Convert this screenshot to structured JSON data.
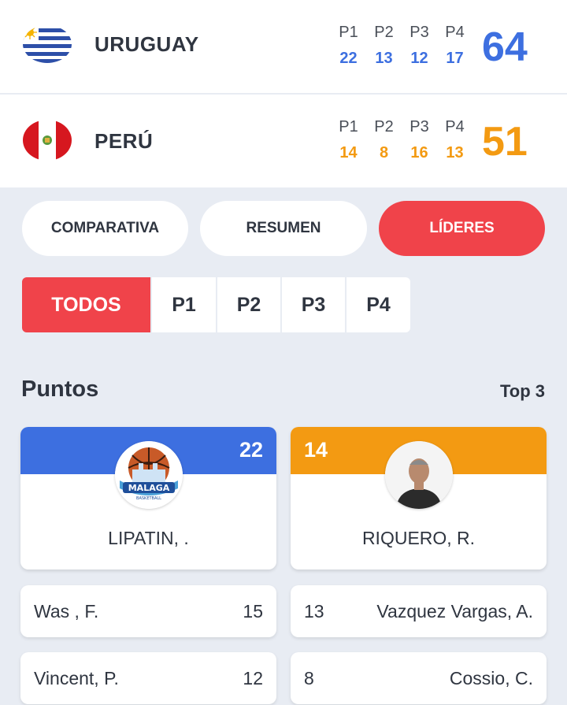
{
  "home": {
    "name": "URUGUAY",
    "flag": "uruguay-flag-icon",
    "period_labels": [
      "P1",
      "P2",
      "P3",
      "P4"
    ],
    "periods": [
      "22",
      "13",
      "12",
      "17"
    ],
    "total": "64",
    "color": "#3d6fe0"
  },
  "away": {
    "name": "PERÚ",
    "flag": "peru-flag-icon",
    "period_labels": [
      "P1",
      "P2",
      "P3",
      "P4"
    ],
    "periods": [
      "14",
      "8",
      "16",
      "13"
    ],
    "total": "51",
    "color": "#f39a12"
  },
  "view_tabs": [
    {
      "label": "COMPARATIVA",
      "active": false
    },
    {
      "label": "RESUMEN",
      "active": false
    },
    {
      "label": "LÍDERES",
      "active": true
    }
  ],
  "period_filter": [
    {
      "label": "TODOS",
      "active": true
    },
    {
      "label": "P1",
      "active": false
    },
    {
      "label": "P2",
      "active": false
    },
    {
      "label": "P3",
      "active": false
    },
    {
      "label": "P4",
      "active": false
    }
  ],
  "section": {
    "title": "Puntos",
    "top_label": "Top 3"
  },
  "leaders": {
    "home": {
      "value": "22",
      "name": "LIPATIN,  .",
      "avatar": "malaga-team-logo"
    },
    "away": {
      "value": "14",
      "name": "RIQUERO, R.",
      "avatar": "player-photo"
    }
  },
  "others": {
    "home": [
      {
        "name": "Was , F.",
        "value": "15"
      },
      {
        "name": "Vincent, P.",
        "value": "12"
      }
    ],
    "away": [
      {
        "name": "Vazquez Vargas, A.",
        "value": "13"
      },
      {
        "name": "Cossio, C.",
        "value": "8"
      }
    ]
  },
  "colors": {
    "accent": "#f0434a",
    "home": "#3d6fe0",
    "away": "#f39a12",
    "background": "#e8ecf3"
  }
}
